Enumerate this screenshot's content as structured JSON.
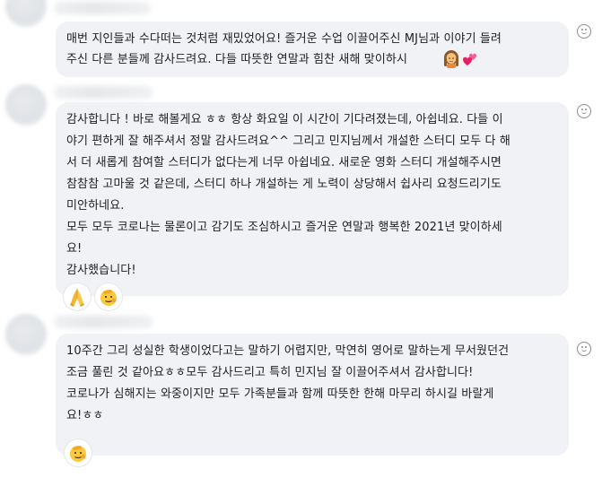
{
  "comments": [
    {
      "lines": [
        "매번 지인들과 수다떠는 것처럼 재밌었어요! 즐거운 수업 이끌어주신 MJ님과 이야기 들려",
        "주신 다른 분들께 감사드려요. 다들 따뜻한 연말과 힘찬 새해 맞이하시"
      ],
      "trailing_emojis": [
        "woman-icon",
        "two-hearts-icon"
      ],
      "reactions": []
    },
    {
      "lines": [
        "감사합니다 ! 바로 해볼게요 ㅎㅎ 항상 화요일 이 시간이 기다려졌는데, 아쉽네요. 다들 이",
        "야기 편하게 잘 해주셔서 정말 감사드려요^^ 그리고 민지님께서 개설한 스터디 모두 다 해",
        "서 더 새롭게 참여할 스터디가 없다는게 너무 아쉽네요. 새로운 영화 스터디 개설해주시면",
        "참참참 고마울 것 같은데, 스터디 하나 개설하는 게 노력이 상당해서 쉽사리 요청드리기도",
        "미안하네요.",
        "모두 모두 코로나는 물론이고 감기도 조심하시고 즐거운 연말과 행복한 2021년 맞이하세",
        "요!",
        "감사했습니다!"
      ],
      "trailing_emojis": [],
      "reactions": [
        "folded-hands-icon",
        "saluting-face-icon"
      ]
    },
    {
      "lines": [
        "10주간 그리 성실한 학생이었다고는 말하기 어렵지만, 막연히 영어로 말하는게 무서웠던건",
        "조금 풀린 것 같아요ㅎㅎ모두 감사드리고 특히 민지님 잘 이끌어주셔서 감사합니다!",
        "코로나가 심해지는 와중이지만 모두 가족분들과 함께 따뜻한 한해 마무리 하시길 바랄게",
        "요!ㅎㅎ"
      ],
      "trailing_emojis": [],
      "reactions": [
        "saluting-face-icon"
      ]
    }
  ]
}
